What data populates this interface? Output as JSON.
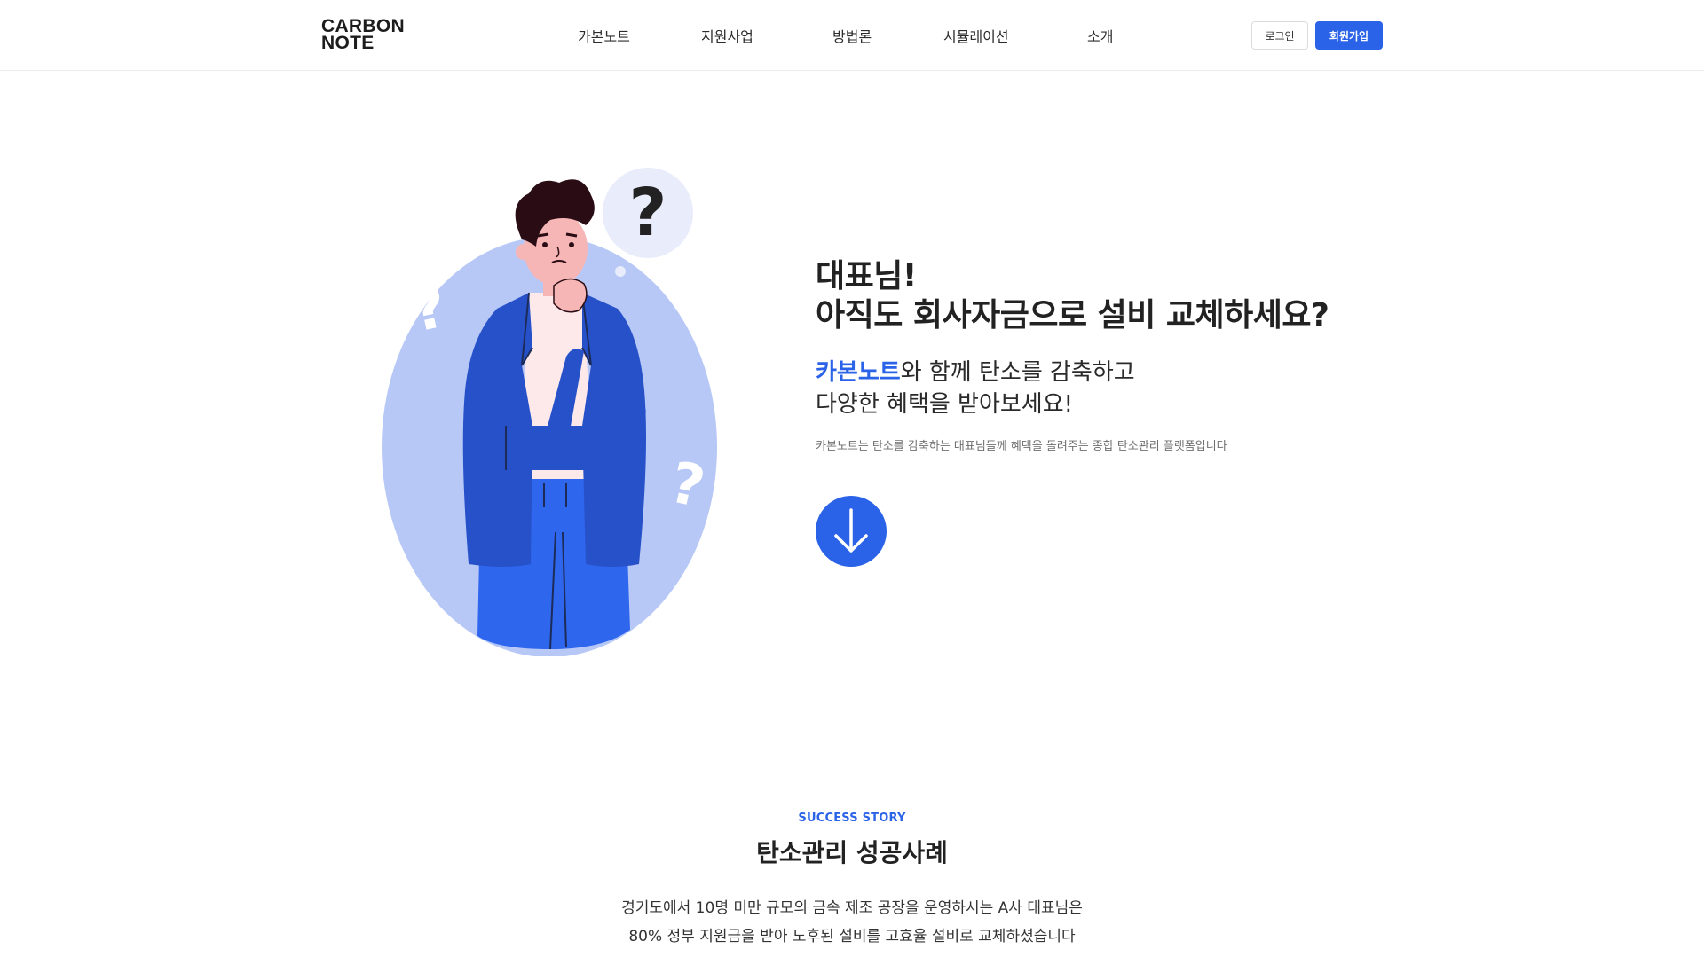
{
  "header": {
    "logo_line1": "CARBON",
    "logo_line2": "NOTE",
    "nav": [
      "카본노트",
      "지원사업",
      "방법론",
      "시뮬레이션",
      "소개"
    ],
    "login_label": "로그인",
    "signup_label": "회원가입"
  },
  "hero": {
    "title_line1": "대표님!",
    "title_line2": "아직도 회사자금으로 설비 교체하세요?",
    "sub_accent": "카본노트",
    "sub_line1_rest": "와 함께 탄소를 감축하고",
    "sub_line2": "다양한 혜택을 받아보세요!",
    "description": "카본노트는 탄소를 감축하는 대표님들께 혜택을 돌려주는 종합 탄소관리 플랫폼입니다",
    "scroll_icon": "arrow-down-icon"
  },
  "story": {
    "eyebrow": "SUCCESS STORY",
    "title": "탄소관리 성공사례",
    "body_line1": "경기도에서 10명 미만 규모의 금속 제조 공장을 운영하시는 A사 대표님은",
    "body_line2": "80% 정부 지원금을 받아 노후된 설비를 고효율 설비로 교체하셨습니다"
  },
  "colors": {
    "brand": "#2a62e8",
    "blob": "#b7c8f7",
    "bubble": "#e8ecfb",
    "jacket": "#2651c9",
    "pants": "#2f66ee"
  }
}
